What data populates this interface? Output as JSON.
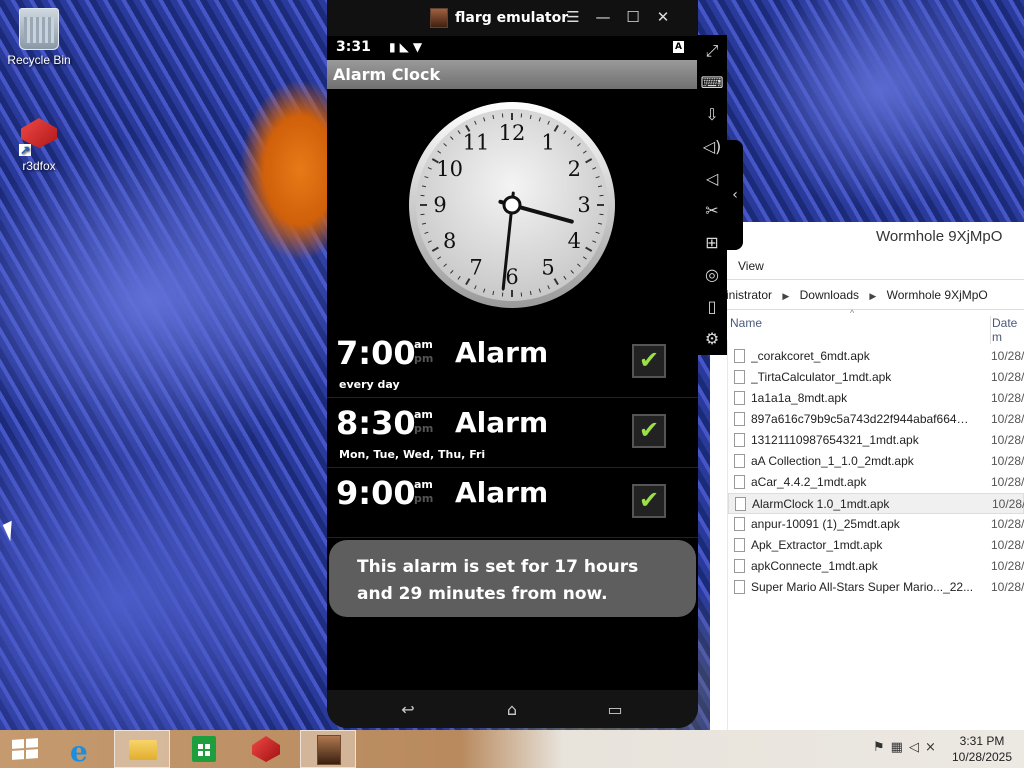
{
  "desktop": {
    "icons": [
      {
        "label": "Recycle Bin"
      },
      {
        "label": "r3dfox"
      }
    ]
  },
  "emulator": {
    "title": "flarg emulator",
    "status_time": "3:31",
    "app_title": "Alarm Clock",
    "clock": {
      "hour": 3,
      "minute": 31,
      "second": 31
    },
    "alarms": [
      {
        "time": "7:00",
        "am": "am",
        "pm": "pm",
        "label": "Alarm",
        "days": "every day",
        "enabled": true
      },
      {
        "time": "8:30",
        "am": "am",
        "pm": "pm",
        "label": "Alarm",
        "days": "Mon, Tue, Wed, Thu, Fri",
        "enabled": true
      },
      {
        "time": "9:00",
        "am": "am",
        "pm": "pm",
        "label": "Alarm",
        "days": "",
        "enabled": true
      }
    ],
    "toast": "This alarm is set for 17 hours and 29 minutes from now.",
    "sidebar_icons": [
      "fullscreen-icon",
      "keyboard-icon",
      "apk-install-icon",
      "volume-up-icon",
      "volume-down-icon",
      "screenshot-icon",
      "add-window-icon",
      "location-icon",
      "shake-icon",
      "settings-icon"
    ]
  },
  "explorer": {
    "title": "Wormhole 9XjMpO",
    "ribbon_view": "View",
    "breadcrumb": [
      "inistrator",
      "Downloads",
      "Wormhole 9XjMpO"
    ],
    "col_name": "Name",
    "col_date": "Date m",
    "files": [
      {
        "name": "_corakcoret_6mdt.apk",
        "date": "10/28/"
      },
      {
        "name": "_TirtaCalculator_1mdt.apk",
        "date": "10/28/"
      },
      {
        "name": "1a1a1a_8mdt.apk",
        "date": "10/28/"
      },
      {
        "name": "897a616c79b9c5a743d22f944abaf664_sig...",
        "date": "10/28/"
      },
      {
        "name": "13121110987654321_1mdt.apk",
        "date": "10/28/"
      },
      {
        "name": "aA Collection_1_1.0_2mdt.apk",
        "date": "10/28/"
      },
      {
        "name": "aCar_4.4.2_1mdt.apk",
        "date": "10/28/"
      },
      {
        "name": "AlarmClock 1.0_1mdt.apk",
        "date": "10/28/",
        "selected": true
      },
      {
        "name": "anpur-10091 (1)_25mdt.apk",
        "date": "10/28/"
      },
      {
        "name": "Apk_Extractor_1mdt.apk",
        "date": "10/28/"
      },
      {
        "name": "apkConnecte_1mdt.apk",
        "date": "10/28/"
      },
      {
        "name": "Super Mario All-Stars  Super Mario..._22...",
        "date": "10/28/"
      }
    ]
  },
  "taskbar": {
    "time": "3:31 PM",
    "date": "10/28/2025"
  }
}
